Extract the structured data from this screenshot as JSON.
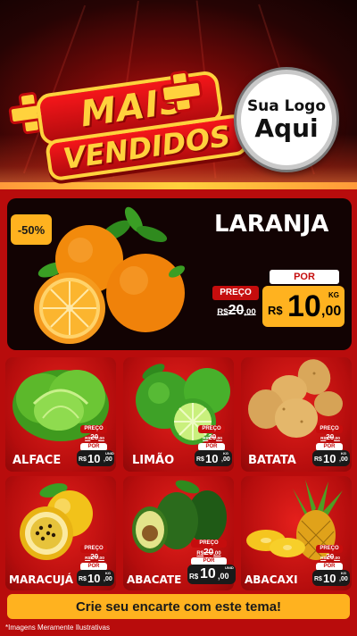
{
  "header": {
    "title_line1": "MAIS",
    "title_line2": "VENDIDOS",
    "logo_line1": "Sua Logo",
    "logo_line2": "Aqui"
  },
  "featured": {
    "discount": "-50%",
    "name": "LARANJA",
    "preco_label": "PREÇO",
    "old_prefix": "R$",
    "old_int": "20",
    "old_dec": ",00",
    "por_label": "POR",
    "currency": "R$",
    "price_int": "10",
    "price_dec": ",00",
    "unit": "KG"
  },
  "products": [
    {
      "name": "ALFACE",
      "preco_label": "PREÇO",
      "old_prefix": "R$",
      "old_int": "20",
      "old_dec": ",00",
      "por_label": "POR",
      "currency": "R$",
      "price_int": "10",
      "price_dec": ",00",
      "unit": "UNID"
    },
    {
      "name": "LIMÃO",
      "preco_label": "PREÇO",
      "old_prefix": "R$",
      "old_int": "20",
      "old_dec": ",00",
      "por_label": "POR",
      "currency": "R$",
      "price_int": "10",
      "price_dec": ",00",
      "unit": "KG"
    },
    {
      "name": "BATATA",
      "preco_label": "PREÇO",
      "old_prefix": "R$",
      "old_int": "20",
      "old_dec": ",00",
      "por_label": "POR",
      "currency": "R$",
      "price_int": "10",
      "price_dec": ",00",
      "unit": "KG"
    },
    {
      "name": "MARACUJÁ",
      "preco_label": "PREÇO",
      "old_prefix": "R$",
      "old_int": "20",
      "old_dec": ",00",
      "por_label": "POR",
      "currency": "R$",
      "price_int": "10",
      "price_dec": ",00",
      "unit": "KG"
    },
    {
      "name": "ABACATE",
      "preco_label": "PREÇO",
      "old_prefix": "R$",
      "old_int": "20",
      "old_dec": ",00",
      "por_label": "POR",
      "currency": "R$",
      "price_int": "10",
      "price_dec": ",00",
      "unit": "UNID"
    },
    {
      "name": "ABACAXI",
      "preco_label": "PREÇO",
      "old_prefix": "R$",
      "old_int": "20",
      "old_dec": ",00",
      "por_label": "POR",
      "currency": "R$",
      "price_int": "10",
      "price_dec": ",00",
      "unit": "KG"
    }
  ],
  "cta": "Crie seu encarte com este tema!",
  "footnote": "*Imagens Meramente Ilustrativas",
  "colors": {
    "accent_yellow": "#ffb21f",
    "brand_red": "#c50d0d",
    "dark": "#120303"
  }
}
